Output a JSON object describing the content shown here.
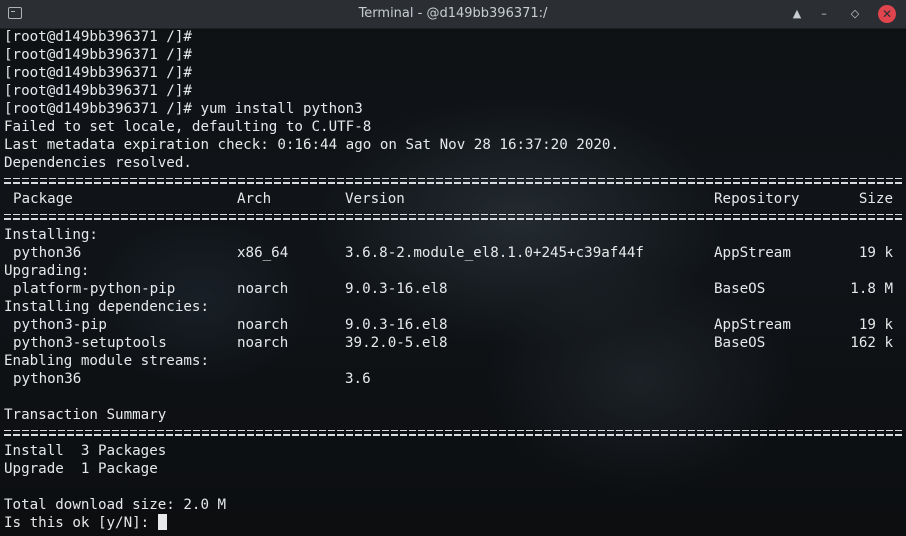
{
  "window": {
    "title": "Terminal - @d149bb396371:/"
  },
  "prompt_lines": [
    "[root@d149bb396371 /]#",
    "[root@d149bb396371 /]#",
    "[root@d149bb396371 /]#",
    "[root@d149bb396371 /]#",
    "[root@d149bb396371 /]# yum install python3"
  ],
  "messages": [
    "Failed to set locale, defaulting to C.UTF-8",
    "Last metadata expiration check: 0:16:44 ago on Sat Nov 28 16:37:20 2020.",
    "Dependencies resolved."
  ],
  "table": {
    "headers": {
      "package": "Package",
      "arch": "Arch",
      "version": "Version",
      "repository": "Repository",
      "size": "Size"
    },
    "sections": {
      "installing": "Installing:",
      "upgrading": "Upgrading:",
      "installing_deps": "Installing dependencies:",
      "enabling_streams": "Enabling module streams:"
    },
    "installing": [
      {
        "package": "python36",
        "arch": "x86_64",
        "version": "3.6.8-2.module_el8.1.0+245+c39af44f",
        "repository": "AppStream",
        "size": "19 k"
      }
    ],
    "upgrading": [
      {
        "package": "platform-python-pip",
        "arch": "noarch",
        "version": "9.0.3-16.el8",
        "repository": "BaseOS",
        "size": "1.8 M"
      }
    ],
    "installing_deps": [
      {
        "package": "python3-pip",
        "arch": "noarch",
        "version": "9.0.3-16.el8",
        "repository": "AppStream",
        "size": "19 k"
      },
      {
        "package": "python3-setuptools",
        "arch": "noarch",
        "version": "39.2.0-5.el8",
        "repository": "BaseOS",
        "size": "162 k"
      }
    ],
    "streams": [
      {
        "package": "python36",
        "version": "3.6"
      }
    ]
  },
  "summary": {
    "title": "Transaction Summary",
    "install": "Install  3 Packages",
    "upgrade": "Upgrade  1 Package",
    "download": "Total download size: 2.0 M",
    "prompt": "Is this ok [y/N]: "
  }
}
